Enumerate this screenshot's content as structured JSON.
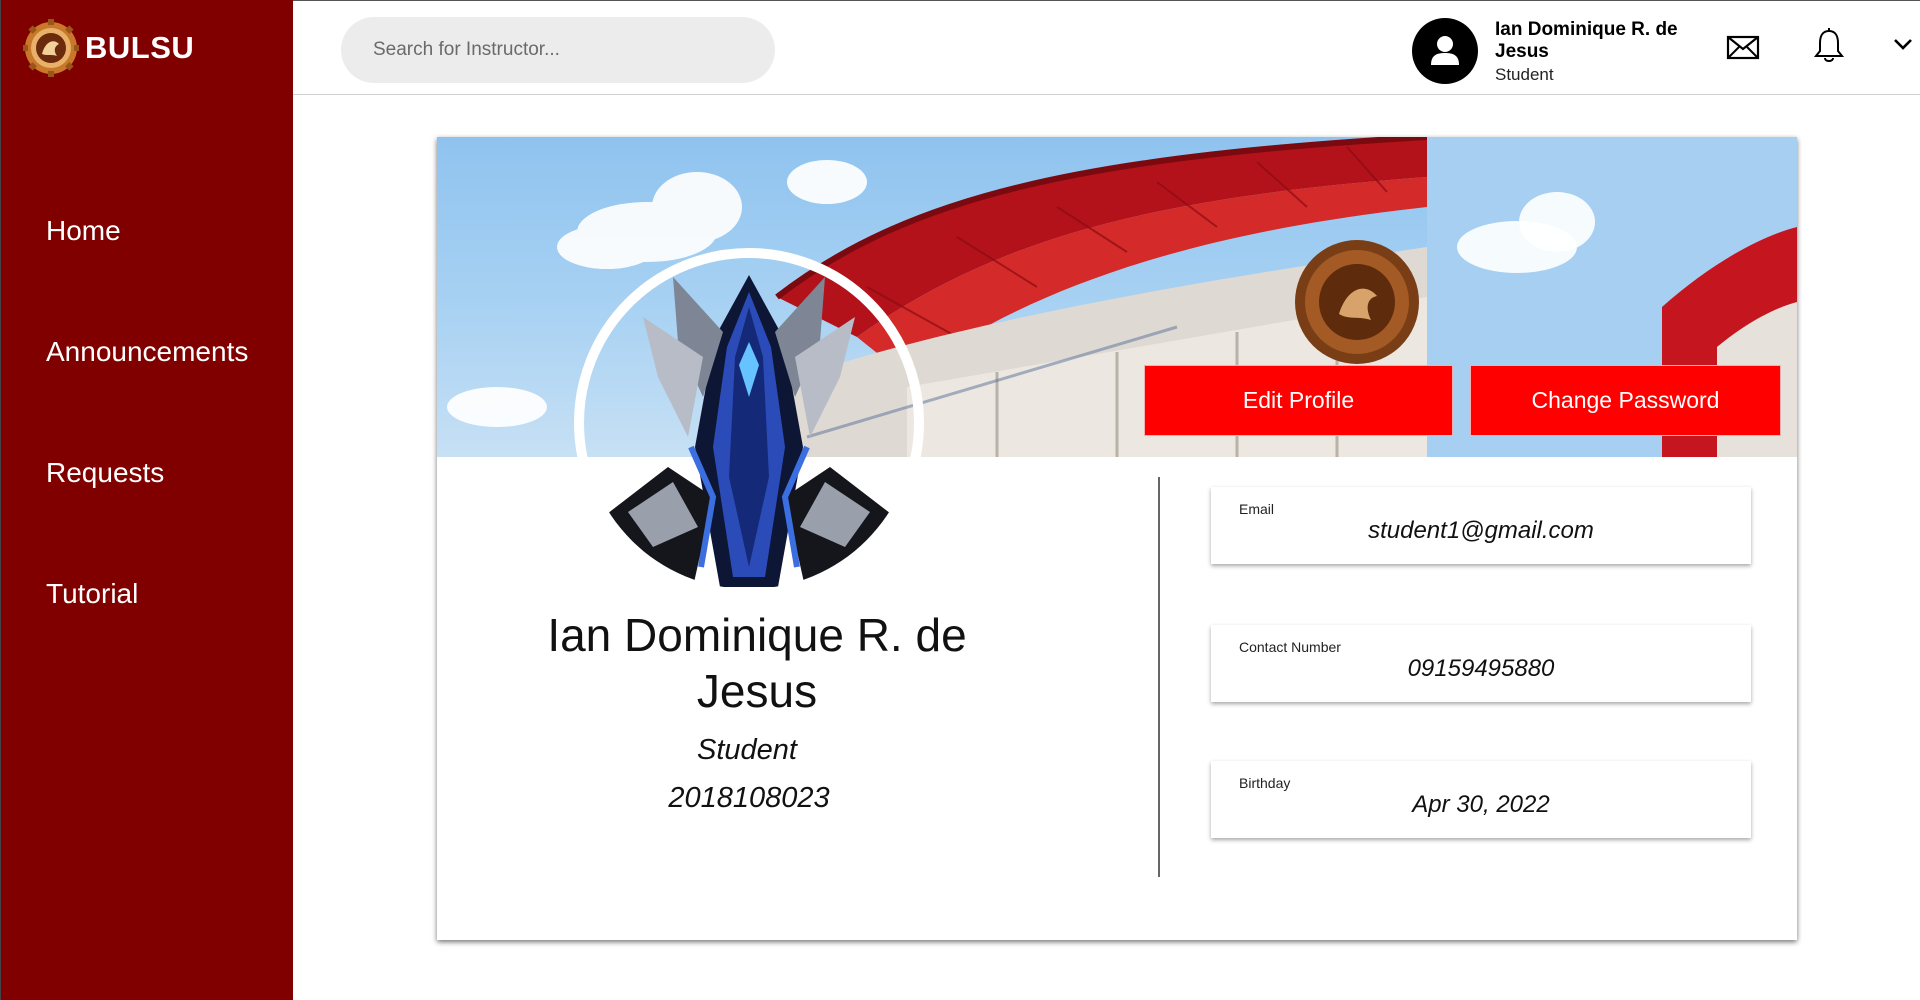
{
  "brand": {
    "name": "BULSU",
    "logo_icon": "university-seal-icon"
  },
  "colors": {
    "sidebar": "#800000",
    "accent_button": "#ff0000",
    "search_bg": "#ececec"
  },
  "sidebar": {
    "items": [
      {
        "label": "Home"
      },
      {
        "label": "Announcements"
      },
      {
        "label": "Requests"
      },
      {
        "label": "Tutorial"
      }
    ]
  },
  "header": {
    "search": {
      "placeholder": "Search for Instructor..."
    },
    "user": {
      "name": "Ian Dominique R. de Jesus",
      "role": "Student",
      "avatar_icon": "user-avatar-icon"
    },
    "icons": [
      "mail-icon",
      "bell-icon",
      "chevron-down-icon"
    ]
  },
  "profile": {
    "cover_image": "bulacan-state-university-building",
    "edit_label": "Edit Profile",
    "change_password_label": "Change Password",
    "name": "Ian Dominique R. de Jesus",
    "role": "Student",
    "student_id": "2018108023",
    "fields": {
      "email": {
        "label": "Email",
        "value": "student1@gmail.com"
      },
      "contact": {
        "label": "Contact Number",
        "value": "09159495880"
      },
      "birthday": {
        "label": "Birthday",
        "value": "Apr 30, 2022"
      }
    }
  }
}
